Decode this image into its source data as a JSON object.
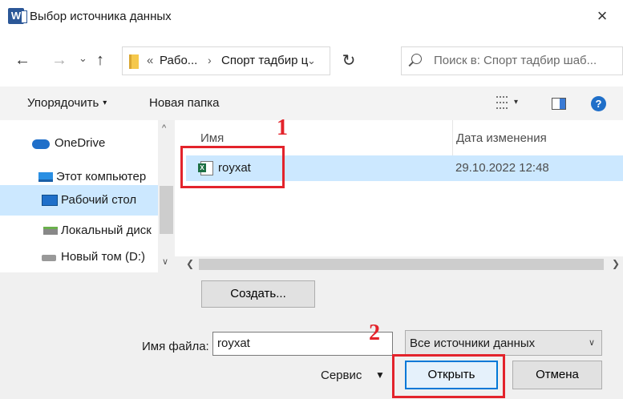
{
  "window": {
    "app_icon_letter": "W",
    "title": "Выбор источника данных",
    "close_glyph": "×"
  },
  "navigation": {
    "back_glyph": "←",
    "forward_glyph": "→",
    "history_glyph": "⌄",
    "up_glyph": "↑",
    "breadcrumb_prefix": "«",
    "breadcrumbs": [
      "Рабо...",
      "Спорт тадбир ц"
    ],
    "breadcrumb_separator": "›",
    "address_dropdown_glyph": "⌄",
    "refresh_glyph": "↻",
    "search_placeholder": "Поиск в: Спорт тадбир шаб..."
  },
  "toolbar": {
    "organize_label": "Упорядочить",
    "new_folder_label": "Новая папка",
    "help_glyph": "?",
    "caret_glyph": "▾"
  },
  "sidebar": {
    "items": [
      {
        "label": "OneDrive",
        "icon": "cloud-icon"
      },
      {
        "label": "Этот компьютер",
        "icon": "computer-icon"
      },
      {
        "label": "Рабочий стол",
        "icon": "desktop-icon",
        "selected": true
      },
      {
        "label": "Локальный диск",
        "icon": "local-disk-icon"
      },
      {
        "label": "Новый том (D:)",
        "icon": "drive-icon"
      }
    ]
  },
  "file_list": {
    "columns": [
      "Имя",
      "Дата изменения"
    ],
    "rows": [
      {
        "name": "royxat",
        "modified": "29.10.2022 12:48",
        "icon": "excel-file-icon",
        "selected": true
      }
    ]
  },
  "actions": {
    "create_label": "Создать...",
    "filename_label": "Имя файла:",
    "filename_value": "royxat",
    "filetype_selected": "Все источники данных",
    "service_label": "Сервис",
    "open_label": "Открыть",
    "cancel_label": "Отмена"
  },
  "annotations": {
    "marker_1": "1",
    "marker_2": "2",
    "color": "#e3232b"
  },
  "colors": {
    "selection": "#cce8ff",
    "accent": "#0078d7"
  }
}
